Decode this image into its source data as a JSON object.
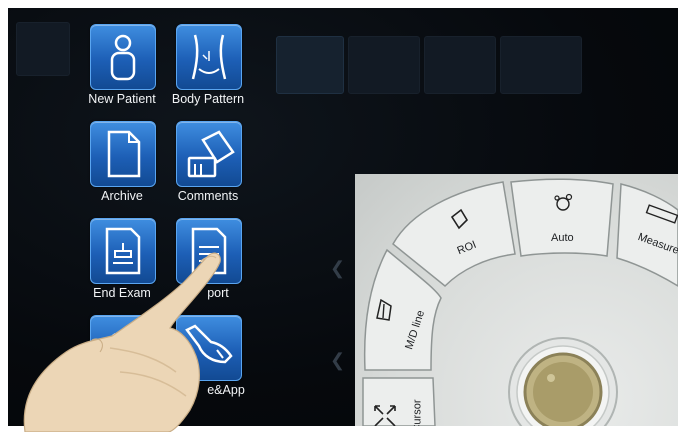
{
  "menu": {
    "items": [
      {
        "label": "New Patient",
        "icon": "patient-icon"
      },
      {
        "label": "Body Pattern",
        "icon": "body-pattern-icon"
      },
      {
        "label": "Archive",
        "icon": "archive-icon"
      },
      {
        "label": "Comments",
        "icon": "comments-icon"
      },
      {
        "label": "End Exam",
        "icon": "end-exam-icon"
      },
      {
        "label": "port",
        "icon": "report-icon"
      },
      {
        "label": "",
        "icon": "gear-icon"
      },
      {
        "label": "e&App",
        "icon": "probe-icon"
      }
    ]
  },
  "control_panel": {
    "keys": [
      {
        "label": "ROI",
        "icon": "roi-icon"
      },
      {
        "label": "Auto",
        "icon": "auto-icon"
      },
      {
        "label": "Measure",
        "icon": "ruler-icon"
      },
      {
        "label": "M/D line",
        "icon": "md-line-icon"
      },
      {
        "label": "Cursor",
        "icon": "cursor-icon"
      }
    ],
    "trackball": "trackball"
  },
  "colors": {
    "tile_top": "#3f8ee0",
    "tile_bottom": "#124a93",
    "screen_bg": "#06090d",
    "panel_bg": "#d8dbd9"
  }
}
